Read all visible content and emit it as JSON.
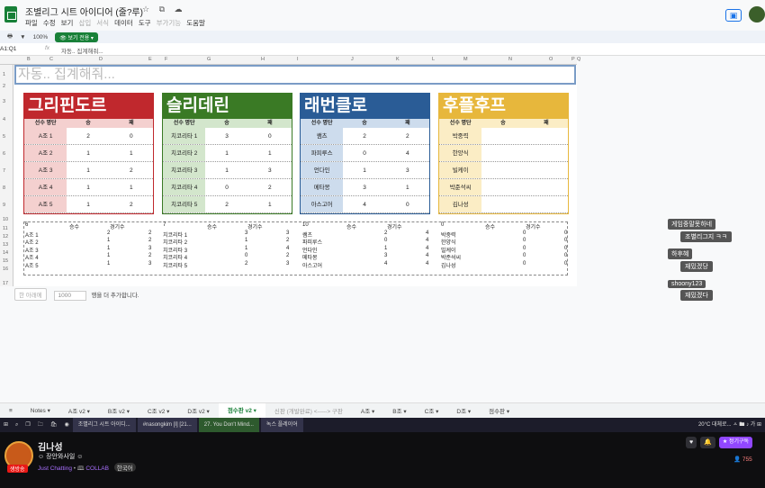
{
  "app": {
    "doc_title": "조별리그 시트 아이디어 (줄?루)",
    "menus": [
      {
        "label": "파일",
        "dim": false
      },
      {
        "label": "수정",
        "dim": false
      },
      {
        "label": "보기",
        "dim": false
      },
      {
        "label": "삽입",
        "dim": true
      },
      {
        "label": "서식",
        "dim": true
      },
      {
        "label": "데이터",
        "dim": false
      },
      {
        "label": "도구",
        "dim": false
      },
      {
        "label": "부가기능",
        "dim": true
      },
      {
        "label": "도움말",
        "dim": false
      }
    ],
    "zoom": "100%",
    "view_only_label": "보기 전용",
    "cell_ref": "A1:Q1",
    "fx": "fx",
    "formula": "자동.. 집계해줘...",
    "a1_text": "자동.. 집계해줘...",
    "columns": [
      "B",
      "C",
      "D",
      "E",
      "F",
      "G",
      "H",
      "I",
      "J",
      "K",
      "L",
      "M",
      "N",
      "O",
      "P",
      "Q"
    ],
    "rows": [
      "1",
      "2",
      "3",
      "4",
      "5",
      "6",
      "7",
      "8",
      "9",
      "10",
      "11",
      "12",
      "13",
      "14",
      "15",
      "16",
      "17"
    ]
  },
  "cards": [
    {
      "title": "그리핀도르",
      "color": "#c0282d",
      "light": "#f4d0cf",
      "headers": [
        "선수 명단",
        "승",
        "패"
      ],
      "rows": [
        [
          "A조 1",
          "2",
          "0"
        ],
        [
          "A조 2",
          "1",
          "1"
        ],
        [
          "A조 3",
          "1",
          "2"
        ],
        [
          "A조 4",
          "1",
          "1"
        ],
        [
          "A조 5",
          "1",
          "2"
        ]
      ]
    },
    {
      "title": "슬리데린",
      "color": "#3a7a25",
      "light": "#d3e6cc",
      "headers": [
        "선수 명단",
        "승",
        "패"
      ],
      "rows": [
        [
          "치코리타 1",
          "3",
          "0"
        ],
        [
          "치코리타 2",
          "1",
          "1"
        ],
        [
          "치코리타 3",
          "1",
          "3"
        ],
        [
          "치코리타 4",
          "0",
          "2"
        ],
        [
          "치코리타 5",
          "2",
          "1"
        ]
      ]
    },
    {
      "title": "래번클로",
      "color": "#2a5c96",
      "light": "#cddced",
      "headers": [
        "선수 명단",
        "승",
        "패"
      ],
      "rows": [
        [
          "쌤츠",
          "2",
          "2"
        ],
        [
          "파피루스",
          "0",
          "4"
        ],
        [
          "언다인",
          "1",
          "3"
        ],
        [
          "메타몽",
          "3",
          "1"
        ],
        [
          "아스고어",
          "4",
          "0"
        ]
      ]
    },
    {
      "title": "후플후프",
      "color": "#e7b73c",
      "light": "#fbedc5",
      "headers": [
        "선수 명단",
        "승",
        "패"
      ],
      "rows": [
        [
          "박중력",
          "",
          ""
        ],
        [
          "한양식",
          "",
          ""
        ],
        [
          "빌케이",
          "",
          ""
        ],
        [
          "박준석씨",
          "",
          ""
        ],
        [
          "김나성",
          "",
          ""
        ]
      ]
    }
  ],
  "data_table": [
    {
      "count": "6",
      "h1": "승수",
      "h2": "경기수",
      "rows": [
        [
          "A조 1",
          "2",
          "2"
        ],
        [
          "A조 2",
          "1",
          "2"
        ],
        [
          "A조 3",
          "1",
          "3"
        ],
        [
          "A조 4",
          "1",
          "2"
        ],
        [
          "A조 5",
          "1",
          "3"
        ]
      ]
    },
    {
      "count": "7",
      "h1": "승수",
      "h2": "경기수",
      "rows": [
        [
          "치코리타 1",
          "3",
          "3"
        ],
        [
          "치코리타 2",
          "1",
          "2"
        ],
        [
          "치코리타 3",
          "1",
          "4"
        ],
        [
          "치코리타 4",
          "0",
          "2"
        ],
        [
          "치코리타 5",
          "2",
          "3"
        ]
      ]
    },
    {
      "count": "10",
      "h1": "승수",
      "h2": "경기수",
      "rows": [
        [
          "쌤츠",
          "2",
          "4"
        ],
        [
          "파피루스",
          "0",
          "4"
        ],
        [
          "언다인",
          "1",
          "4"
        ],
        [
          "메타몽",
          "3",
          "4"
        ],
        [
          "아스고어",
          "4",
          "4"
        ]
      ]
    },
    {
      "count": "0",
      "h1": "승수",
      "h2": "경기수",
      "rows": [
        [
          "박중력",
          "0",
          "0"
        ],
        [
          "한양식",
          "0",
          "0"
        ],
        [
          "빌케이",
          "0",
          "0"
        ],
        [
          "박준석씨",
          "0",
          "0"
        ],
        [
          "김나성",
          "0",
          "0"
        ]
      ]
    }
  ],
  "add_rows": {
    "button": "한 아래에",
    "value": "1000",
    "suffix": "행을 더 추가합니다."
  },
  "sheet_tabs": [
    {
      "label": "≡",
      "state": "normal"
    },
    {
      "label": "Notes ▾",
      "state": "normal"
    },
    {
      "label": "A조 v2 ▾",
      "state": "normal"
    },
    {
      "label": "B조 v2 ▾",
      "state": "normal"
    },
    {
      "label": "C조 v2 ▾",
      "state": "normal"
    },
    {
      "label": "D조 v2 ▾",
      "state": "normal"
    },
    {
      "label": "점수판 v2 ▾",
      "state": "active"
    },
    {
      "label": "신판 (개발완료) <-----> 구판",
      "state": "dim"
    },
    {
      "label": "A조 ▾",
      "state": "normal"
    },
    {
      "label": "B조 ▾",
      "state": "normal"
    },
    {
      "label": "C조 ▾",
      "state": "normal"
    },
    {
      "label": "D조 ▾",
      "state": "normal"
    },
    {
      "label": "점수판 ▾",
      "state": "normal"
    }
  ],
  "taskbar": {
    "windows": [
      {
        "label": "조별리그 시트 아이디...",
        "active": false
      },
      {
        "label": "#nasongkim [I] [21...",
        "active": false
      },
      {
        "label": "27. You Don't Mind...",
        "active": true
      },
      {
        "label": "녹스 플레이어",
        "active": false
      }
    ],
    "weather": "20°C 대체로...",
    "tray": "ㅅ 🖿 ♪ 가 ⊞"
  },
  "chat": [
    {
      "name": "게임중말못하네",
      "msg": "조별리그지 ㅋㅋ"
    },
    {
      "name": "하후혜",
      "msg": "재밌겠당"
    },
    {
      "name": "shoony123",
      "msg": "재밌겠다"
    }
  ],
  "stream": {
    "name": "김나성",
    "title": "장안와사일",
    "category": "Just Chatting",
    "collab": "COLLAB",
    "tag": "한국어",
    "live": "생방송",
    "sub_label": "정기구독",
    "viewers": "755"
  }
}
